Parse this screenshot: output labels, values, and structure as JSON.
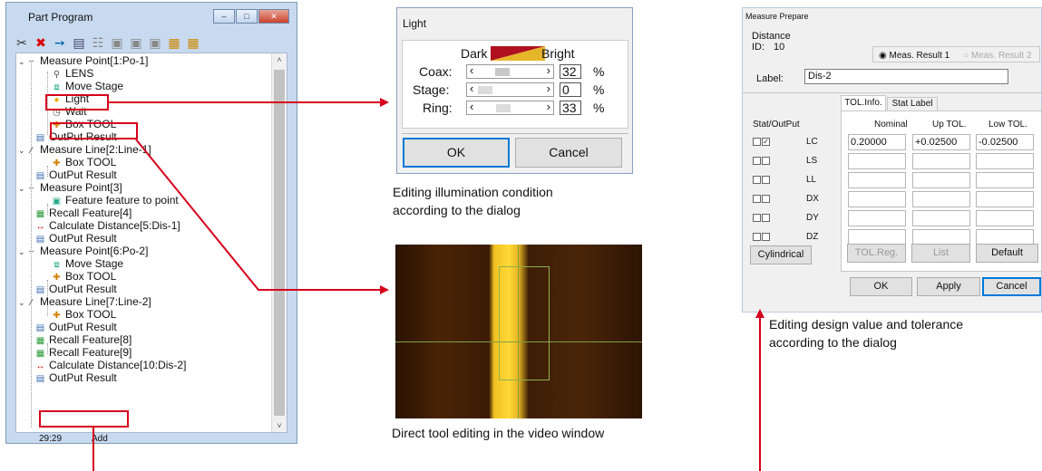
{
  "part_program": {
    "title": "Part Program",
    "toolbar_icons": [
      "scissors-icon",
      "delete-icon",
      "info-icon",
      "tool-icon-1",
      "tool-icon-2",
      "tool-icon-3",
      "tool-icon-4",
      "tool-icon-5",
      "tool-icon-6",
      "tool-icon-7"
    ],
    "tree": [
      {
        "label": "Measure Point[1:Po-1]"
      },
      {
        "label": "LENS"
      },
      {
        "label": "Move Stage"
      },
      {
        "label": "Light"
      },
      {
        "label": "Wait"
      },
      {
        "label": "Box TOOL"
      },
      {
        "label": "OutPut Result"
      },
      {
        "label": "Measure Line[2:Line-1]"
      },
      {
        "label": "Box TOOL"
      },
      {
        "label": "OutPut Result"
      },
      {
        "label": "Measure Point[3]"
      },
      {
        "label": "Feature feature to point"
      },
      {
        "label": "Recall Feature[4]"
      },
      {
        "label": "Calculate Distance[5:Dis-1]"
      },
      {
        "label": "OutPut Result"
      },
      {
        "label": "Measure Point[6:Po-2]"
      },
      {
        "label": "Move Stage"
      },
      {
        "label": "Box TOOL"
      },
      {
        "label": "OutPut Result"
      },
      {
        "label": "Measure Line[7:Line-2]"
      },
      {
        "label": "Box TOOL"
      },
      {
        "label": "OutPut Result"
      },
      {
        "label": "Recall Feature[8]"
      },
      {
        "label": "Recall Feature[9]"
      },
      {
        "label": "Calculate Distance[10:Dis-2]"
      },
      {
        "label": "OutPut Result"
      }
    ],
    "status": {
      "position": "29:29",
      "mode": "Add"
    }
  },
  "light_dialog": {
    "title": "Light",
    "dark_label": "Dark",
    "bright_label": "Bright",
    "rows": [
      {
        "label": "Coax:",
        "value": "32",
        "unit": "%",
        "level": 0.32
      },
      {
        "label": "Stage:",
        "value": "0",
        "unit": "%",
        "level": 0.0
      },
      {
        "label": "Ring:",
        "value": "33",
        "unit": "%",
        "level": 0.33
      }
    ],
    "ok_label": "OK",
    "cancel_label": "Cancel",
    "caption_line1": "Editing illumination condition",
    "caption_line2": "according to the dialog"
  },
  "video": {
    "caption": "Direct tool editing in the video window"
  },
  "measure_prepare": {
    "title": "Measure Prepare",
    "distance_label": "Distance",
    "id_label": "ID:",
    "id_value": "10",
    "result1_label": "Meas. Result 1",
    "result2_label": "Meas. Result 2",
    "label_label": "Label:",
    "label_value": "Dis-2",
    "tab_tol": "TOL.Info.",
    "tab_stat": "Stat Label",
    "stat_output_label": "Stat/OutPut",
    "col_nominal": "Nominal",
    "col_up": "Up TOL.",
    "col_low": "Low TOL.",
    "rows": [
      {
        "code": "LC",
        "nominal": "0.20000",
        "up": "+0.02500",
        "low": "-0.02500"
      },
      {
        "code": "LS",
        "nominal": "",
        "up": "",
        "low": ""
      },
      {
        "code": "LL",
        "nominal": "",
        "up": "",
        "low": ""
      },
      {
        "code": "DX",
        "nominal": "",
        "up": "",
        "low": ""
      },
      {
        "code": "DY",
        "nominal": "",
        "up": "",
        "low": ""
      },
      {
        "code": "DZ",
        "nominal": "",
        "up": "",
        "low": ""
      }
    ],
    "cylindrical_label": "Cylindrical",
    "tolreg_label": "TOL.Reg.",
    "list_label": "List",
    "default_label": "Default",
    "ok_label": "OK",
    "apply_label": "Apply",
    "cancel_label": "Cancel",
    "caption_line1": "Editing design value and tolerance",
    "caption_line2": "according to the dialog"
  },
  "colors": {
    "accent_red": "#d6001c",
    "focus_blue": "#0078d7"
  }
}
